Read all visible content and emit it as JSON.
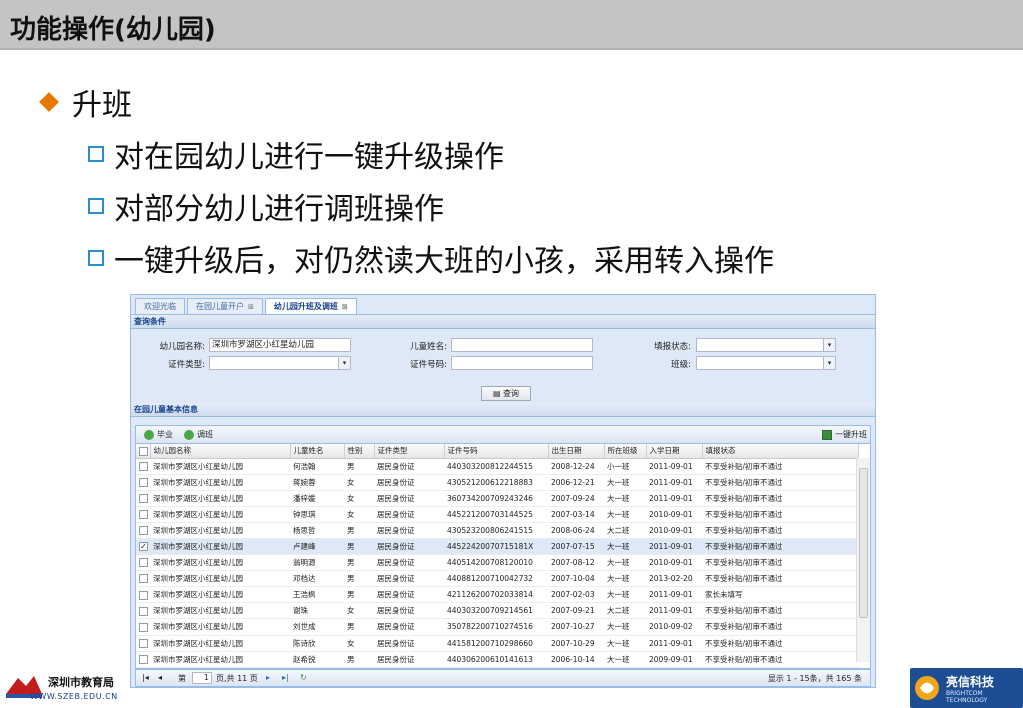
{
  "slide": {
    "title": "功能操作(幼儿园)",
    "bullet": "升班",
    "subbullets": [
      "对在园幼儿进行一键升级操作",
      "对部分幼儿进行调班操作",
      "一键升级后，对仍然读大班的小孩，采用转入操作"
    ]
  },
  "app": {
    "tabs": [
      "欢迎光临",
      "在园儿童开户",
      "幼儿园升班及调班"
    ],
    "query_header": "查询条件",
    "form": {
      "school_label": "幼儿园名称:",
      "school_value": "深圳市罗湖区小红星幼儿园",
      "child_name_label": "儿童姓名:",
      "status_label": "填报状态:",
      "cert_type_label": "证件类型:",
      "cert_no_label": "证件号码:",
      "class_label": "班级:",
      "query_button": "查询"
    },
    "grid_header": "在园儿童基本信息",
    "toolbar": {
      "graduate": "毕业",
      "transfer": "调班",
      "upgrade": "一键升班"
    },
    "columns": [
      "幼儿园名称",
      "儿童姓名",
      "性别",
      "证件类型",
      "证件号码",
      "出生日期",
      "所在班级",
      "入学日期",
      "填报状态"
    ],
    "rows": [
      [
        "深圳市罗湖区小红星幼儿园",
        "何浩翰",
        "男",
        "居民身份证",
        "440303200812244515",
        "2008-12-24",
        "小一班",
        "2011-09-01",
        "不享受补贴/初审不通过"
      ],
      [
        "深圳市罗湖区小红星幼儿园",
        "蒋婉蓉",
        "女",
        "居民身份证",
        "430521200612218883",
        "2006-12-21",
        "大一班",
        "2011-09-01",
        "不享受补贴/初审不通过"
      ],
      [
        "深圳市罗湖区小红星幼儿园",
        "潘梓媛",
        "女",
        "居民身份证",
        "360734200709243246",
        "2007-09-24",
        "大一班",
        "2011-09-01",
        "不享受补贴/初审不通过"
      ],
      [
        "深圳市罗湖区小红星幼儿园",
        "钟思琪",
        "女",
        "居民身份证",
        "445221200703144525",
        "2007-03-14",
        "大一班",
        "2010-09-01",
        "不享受补贴/初审不通过"
      ],
      [
        "深圳市罗湖区小红星幼儿园",
        "杨思哲",
        "男",
        "居民身份证",
        "430523200806241515",
        "2008-06-24",
        "大二班",
        "2010-09-01",
        "不享受补贴/初审不通过"
      ],
      [
        "深圳市罗湖区小红星幼儿园",
        "卢建峰",
        "男",
        "居民身份证",
        "44522420070715181X",
        "2007-07-15",
        "大一班",
        "2011-09-01",
        "不享受补贴/初审不通过"
      ],
      [
        "深圳市罗湖区小红星幼儿园",
        "翁明源",
        "男",
        "居民身份证",
        "440514200708120010",
        "2007-08-12",
        "大一班",
        "2010-09-01",
        "不享受补贴/初审不通过"
      ],
      [
        "深圳市罗湖区小红星幼儿园",
        "邓档达",
        "男",
        "居民身份证",
        "440881200710042732",
        "2007-10-04",
        "大一班",
        "2013-02-20",
        "不享受补贴/初审不通过"
      ],
      [
        "深圳市罗湖区小红星幼儿园",
        "王浩枫",
        "男",
        "居民身份证",
        "421126200702033814",
        "2007-02-03",
        "大一班",
        "2011-09-01",
        "家长未填写"
      ],
      [
        "深圳市罗湖区小红星幼儿园",
        "谢珠",
        "女",
        "居民身份证",
        "440303200709214561",
        "2007-09-21",
        "大二班",
        "2011-09-01",
        "不享受补贴/初审不通过"
      ],
      [
        "深圳市罗湖区小红星幼儿园",
        "刘世成",
        "男",
        "居民身份证",
        "350782200710274516",
        "2007-10-27",
        "大一班",
        "2010-09-02",
        "不享受补贴/初审不通过"
      ],
      [
        "深圳市罗湖区小红星幼儿园",
        "陈诗欣",
        "女",
        "居民身份证",
        "441581200710298660",
        "2007-10-29",
        "大一班",
        "2011-09-01",
        "不享受补贴/初审不通过"
      ],
      [
        "深圳市罗湖区小红星幼儿园",
        "赵希锐",
        "男",
        "居民身份证",
        "440306200610141613",
        "2006-10-14",
        "大一班",
        "2009-09-01",
        "不享受补贴/初审不通过"
      ]
    ],
    "pager": {
      "prefix": "第",
      "page": "1",
      "suffix": "页,共 11 页",
      "summary": "显示 1 - 15条，共 165 条"
    }
  },
  "footer": {
    "left_logo_text": "深圳市教育局",
    "left_logo_url": "WWW.SZEB.EDU.CN",
    "right_logo_text": "亮信科技",
    "right_logo_sub": "BRIGHTCOM TECHNOLOGY"
  },
  "colors": {
    "accent_orange": "#e67700",
    "bullet_blue": "#2a8fc9",
    "ext_blue": "#99bbe8"
  }
}
